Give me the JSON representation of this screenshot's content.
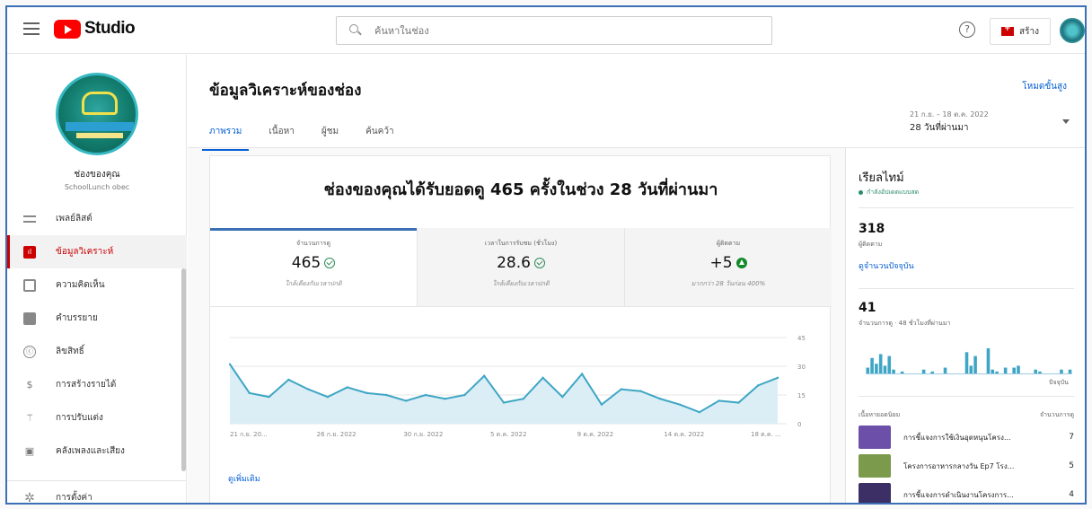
{
  "topbar": {
    "brand": "Studio",
    "search_placeholder": "ค้นหาในช่อง",
    "help_symbol": "?",
    "create_label": "สร้าง"
  },
  "sidebar": {
    "channel_title": "ช่องของคุณ",
    "channel_subtitle": "SchoolLunch obec",
    "items": [
      {
        "label": "เพลย์ลิสต์",
        "icon": "playlist-icon"
      },
      {
        "label": "ข้อมูลวิเคราะห์",
        "icon": "analytics-icon",
        "active": true
      },
      {
        "label": "ความคิดเห็น",
        "icon": "comment-icon"
      },
      {
        "label": "คำบรรยาย",
        "icon": "subtitles-icon"
      },
      {
        "label": "ลิขสิทธิ์",
        "icon": "copyright-icon"
      },
      {
        "label": "การสร้างรายได้",
        "icon": "dollar-icon"
      },
      {
        "label": "การปรับแต่ง",
        "icon": "magic-wand-icon"
      },
      {
        "label": "คลังเพลงและเสียง",
        "icon": "audio-library-icon"
      }
    ],
    "settings_label": "การตั้งค่า",
    "icons": {
      "copyright": "ⓒ",
      "dollar": "$",
      "wand": "⚚",
      "library": "▣",
      "settings": "✲",
      "analytics": "ıl"
    }
  },
  "page": {
    "title": "ข้อมูลวิเคราะห์ของช่อง",
    "advanced": "โหมดขั้นสูง",
    "tabs": [
      "ภาพรวม",
      "เนื้อหา",
      "ผู้ชม",
      "ค้นคว้า"
    ],
    "date_range_small": "21 ก.ย. – 18 ต.ค. 2022",
    "date_range_label": "28 วันที่ผ่านมา"
  },
  "summary": {
    "headline": "ช่องของคุณได้รับยอดดู 465 ครั้งในช่วง 28 วันที่ผ่านมา",
    "metrics": [
      {
        "label": "จำนวนการดู",
        "value": "465",
        "note": "ใกล้เคียงกับเวลาปกติ"
      },
      {
        "label": "เวลาในการรับชม (ชั่วโมง)",
        "value": "28.6",
        "note": "ใกล้เคียงกับเวลาปกติ"
      },
      {
        "label": "ผู้ติดตาม",
        "value": "+5",
        "note": "มากกว่า 28 วันก่อน 400%"
      }
    ],
    "more_link": "ดูเพิ่มเติม"
  },
  "chart_data": {
    "type": "area",
    "x": [
      "21 ก.ย. 20...",
      "26 ก.ย. 2022",
      "30 ก.ย. 2022",
      "5 ต.ค. 2022",
      "9 ต.ค. 2022",
      "14 ต.ค. 2022",
      "18 ต.ค. ..."
    ],
    "y_ticks": [
      "45",
      "30",
      "15",
      "0"
    ],
    "ylim": [
      0,
      45
    ],
    "values": [
      31,
      16,
      14,
      23,
      18,
      14,
      19,
      16,
      15,
      12,
      15,
      13,
      15,
      25,
      11,
      13,
      24,
      14,
      26,
      10,
      18,
      17,
      13,
      10,
      6,
      12,
      11,
      20,
      24
    ],
    "xlabel": "",
    "ylabel": "",
    "color": "#3ea6c4",
    "grid": true
  },
  "realtime": {
    "title": "เรียลไทม์",
    "live": "กำลังอัปเดตแบบสด",
    "subs_value": "318",
    "subs_label": "ผู้ติดตาม",
    "subs_link": "ดูจำนวนปัจจุบัน",
    "views_value": "41",
    "views_label": "จำนวนการดู · 48 ชั่วโมงที่ผ่านมา",
    "now_label": "ปัจจุบัน",
    "bars": [
      3,
      8,
      5,
      10,
      4,
      9,
      2,
      0,
      1,
      0,
      0,
      0,
      0,
      2,
      0,
      1,
      0,
      0,
      3,
      0,
      0,
      0,
      0,
      11,
      4,
      9,
      0,
      0,
      13,
      2,
      1,
      0,
      3,
      0,
      3,
      4,
      0,
      0,
      0,
      2,
      1,
      0,
      0,
      0,
      0,
      2,
      0,
      2
    ],
    "videos_header": "เนื้อหายอดนิยม",
    "videos_header_right": "จำนวนการดู",
    "videos": [
      {
        "title": "การชี้แจงการใช้เงินอุดหนุนโครง...",
        "views": "7",
        "color": "#6b4fa8"
      },
      {
        "title": "โครงการอาหารกลางวัน Ep7 โรง...",
        "views": "5",
        "color": "#7c9a4c"
      },
      {
        "title": "การชี้แจงการดำเนินงานโครงการ...",
        "views": "4",
        "color": "#3c2f66"
      }
    ]
  }
}
